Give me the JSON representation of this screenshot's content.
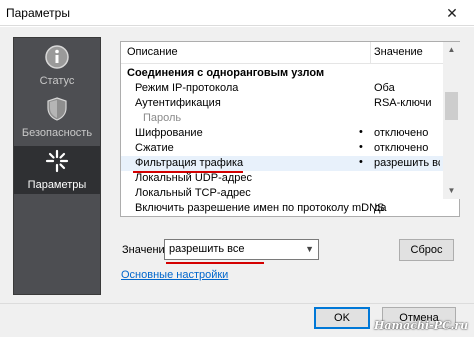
{
  "window": {
    "title": "Параметры",
    "close_glyph": "✕"
  },
  "sidebar": {
    "items": [
      {
        "label": "Статус",
        "icon": "info-icon",
        "active": false
      },
      {
        "label": "Безопасность",
        "icon": "shield-icon",
        "active": false
      },
      {
        "label": "Параметры",
        "icon": "settings-icon",
        "active": true
      }
    ]
  },
  "table": {
    "col_description": "Описание",
    "col_value": "Значение",
    "rows": [
      {
        "name": "Соединения с одноранговым узлом",
        "value": "",
        "dot": ""
      },
      {
        "name": "Режим IP-протокола",
        "value": "Оба",
        "dot": ""
      },
      {
        "name": "Аутентификация",
        "value": "RSA-ключи",
        "dot": ""
      },
      {
        "name": "Пароль",
        "value": "",
        "dot": ""
      },
      {
        "name": "Шифрование",
        "value": "отключено",
        "dot": "•"
      },
      {
        "name": "Сжатие",
        "value": "отключено",
        "dot": "•"
      },
      {
        "name": "Фильтрация трафика",
        "value": "разрешить все",
        "dot": "•"
      },
      {
        "name": "Локальный UDP-адрес",
        "value": "",
        "dot": ""
      },
      {
        "name": "Локальный TCP-адрес",
        "value": "",
        "dot": ""
      },
      {
        "name": "Включить разрешение имен по протоколу mDNS",
        "value": "да",
        "dot": ""
      }
    ]
  },
  "value_editor": {
    "label": "Значение",
    "selected": "разрешить все",
    "reset_label": "Сброс"
  },
  "basic_settings_link": "Основные настройки",
  "footer": {
    "ok_label": "OK",
    "cancel_label": "Отмена"
  },
  "watermark": "Hamachi-PC.ru",
  "colors": {
    "sidebar_bg": "#4d4e52",
    "sidebar_active": "#2f3033",
    "highlight_red": "#d40000",
    "link": "#0066cc",
    "accent_blue": "#0078d7"
  }
}
